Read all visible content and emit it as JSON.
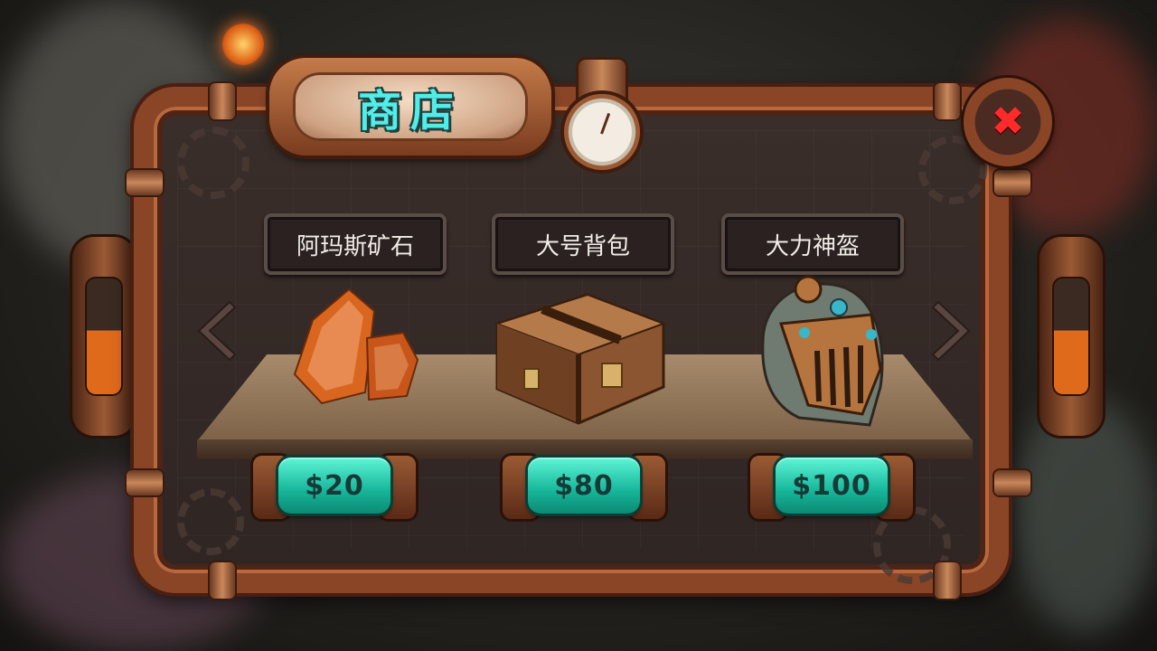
{
  "shop": {
    "title": "商店",
    "items": [
      {
        "name": "阿玛斯矿石",
        "price": "$20",
        "icon": "orange-crystal-ore-icon"
      },
      {
        "name": "大号背包",
        "price": "$80",
        "icon": "leather-chest-backpack-icon"
      },
      {
        "name": "大力神盔",
        "price": "$100",
        "icon": "steampunk-helmet-icon"
      }
    ]
  },
  "colors": {
    "accent": "#52ece9",
    "price_button": "#16b59a",
    "frame_copper": "#8a4526",
    "close_icon": "#ff2a2a"
  }
}
